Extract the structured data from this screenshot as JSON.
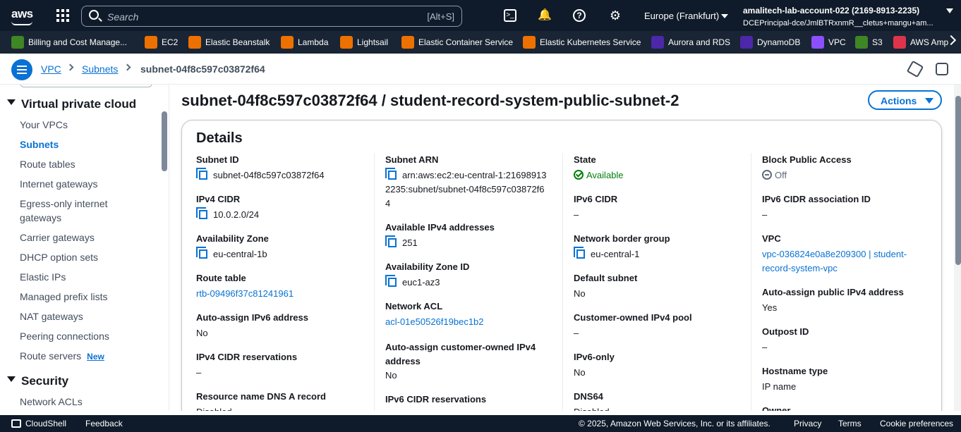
{
  "topnav": {
    "logo": "aws",
    "search_placeholder": "Search",
    "search_shortcut": "[Alt+S]",
    "region": "Europe (Frankfurt)",
    "account_name": "amalitech-lab-account-022 (2169-8913-2235)",
    "account_principal": "DCEPrincipal-dce/JmlBTRxnmR__cletus+mangu+am..."
  },
  "favorites": [
    {
      "label": "Billing and Cost Manage...",
      "color": "#3f8624"
    },
    {
      "label": "EC2",
      "color": "#ed7100"
    },
    {
      "label": "Elastic Beanstalk",
      "color": "#ed7100"
    },
    {
      "label": "Lambda",
      "color": "#ed7100"
    },
    {
      "label": "Lightsail",
      "color": "#ed7100"
    },
    {
      "label": "Elastic Container Service",
      "color": "#ed7100"
    },
    {
      "label": "Elastic Kubernetes Service",
      "color": "#ed7100"
    },
    {
      "label": "Aurora and RDS",
      "color": "#4d27aa"
    },
    {
      "label": "DynamoDB",
      "color": "#4d27aa"
    },
    {
      "label": "VPC",
      "color": "#8c4fff"
    },
    {
      "label": "S3",
      "color": "#3f8624"
    },
    {
      "label": "AWS Amp",
      "color": "#dd344c"
    }
  ],
  "breadcrumb": {
    "vpc": "VPC",
    "subnets": "Subnets",
    "current": "subnet-04f8c597c03872f64"
  },
  "sidebar": {
    "section1": "Virtual private cloud",
    "items": [
      {
        "label": "Your VPCs"
      },
      {
        "label": "Subnets"
      },
      {
        "label": "Route tables"
      },
      {
        "label": "Internet gateways"
      },
      {
        "label": "Egress-only internet gateways"
      },
      {
        "label": "Carrier gateways"
      },
      {
        "label": "DHCP option sets"
      },
      {
        "label": "Elastic IPs"
      },
      {
        "label": "Managed prefix lists"
      },
      {
        "label": "NAT gateways"
      },
      {
        "label": "Peering connections"
      },
      {
        "label": "Route servers"
      }
    ],
    "new_badge": "New",
    "section2": "Security",
    "security_items": [
      {
        "label": "Network ACLs"
      }
    ]
  },
  "page": {
    "title": "subnet-04f8c597c03872f64 / student-record-system-public-subnet-2",
    "actions_label": "Actions",
    "details_heading": "Details"
  },
  "details": {
    "col1": [
      {
        "label": "Subnet ID",
        "value": "subnet-04f8c597c03872f64"
      },
      {
        "label": "IPv4 CIDR",
        "value": "10.0.2.0/24"
      },
      {
        "label": "Availability Zone",
        "value": "eu-central-1b"
      },
      {
        "label": "Route table",
        "value": "rtb-09496f37c81241961"
      },
      {
        "label": "Auto-assign IPv6 address",
        "value": "No"
      },
      {
        "label": "IPv4 CIDR reservations",
        "value": "–"
      },
      {
        "label": "Resource name DNS A record",
        "value": "Disabled"
      }
    ],
    "col2": [
      {
        "label": "Subnet ARN",
        "value": "arn:aws:ec2:eu-central-1:216989132235:subnet/subnet-04f8c597c03872f64"
      },
      {
        "label": "Available IPv4 addresses",
        "value": "251"
      },
      {
        "label": "Availability Zone ID",
        "value": "euc1-az3"
      },
      {
        "label": "Network ACL",
        "value": "acl-01e50526f19bec1b2"
      },
      {
        "label": "Auto-assign customer-owned IPv4 address",
        "value": "No"
      },
      {
        "label": "IPv6 CIDR reservations",
        "value": ""
      }
    ],
    "col3": [
      {
        "label": "State",
        "value": "Available"
      },
      {
        "label": "IPv6 CIDR",
        "value": "–"
      },
      {
        "label": "Network border group",
        "value": "eu-central-1"
      },
      {
        "label": "Default subnet",
        "value": "No"
      },
      {
        "label": "Customer-owned IPv4 pool",
        "value": "–"
      },
      {
        "label": "IPv6-only",
        "value": "No"
      },
      {
        "label": "DNS64",
        "value": "Disabled"
      }
    ],
    "col4": [
      {
        "label": "Block Public Access",
        "value": "Off"
      },
      {
        "label": "IPv6 CIDR association ID",
        "value": "–"
      },
      {
        "label": "VPC",
        "value": "vpc-036824e0a8e209300 | student-record-system-vpc"
      },
      {
        "label": "Auto-assign public IPv4 address",
        "value": "Yes"
      },
      {
        "label": "Outpost ID",
        "value": "–"
      },
      {
        "label": "Hostname type",
        "value": "IP name"
      },
      {
        "label": "Owner",
        "value": ""
      }
    ]
  },
  "footer": {
    "cloudshell": "CloudShell",
    "feedback": "Feedback",
    "copyright": "© 2025, Amazon Web Services, Inc. or its affiliates.",
    "privacy": "Privacy",
    "terms": "Terms",
    "cookies": "Cookie preferences"
  }
}
